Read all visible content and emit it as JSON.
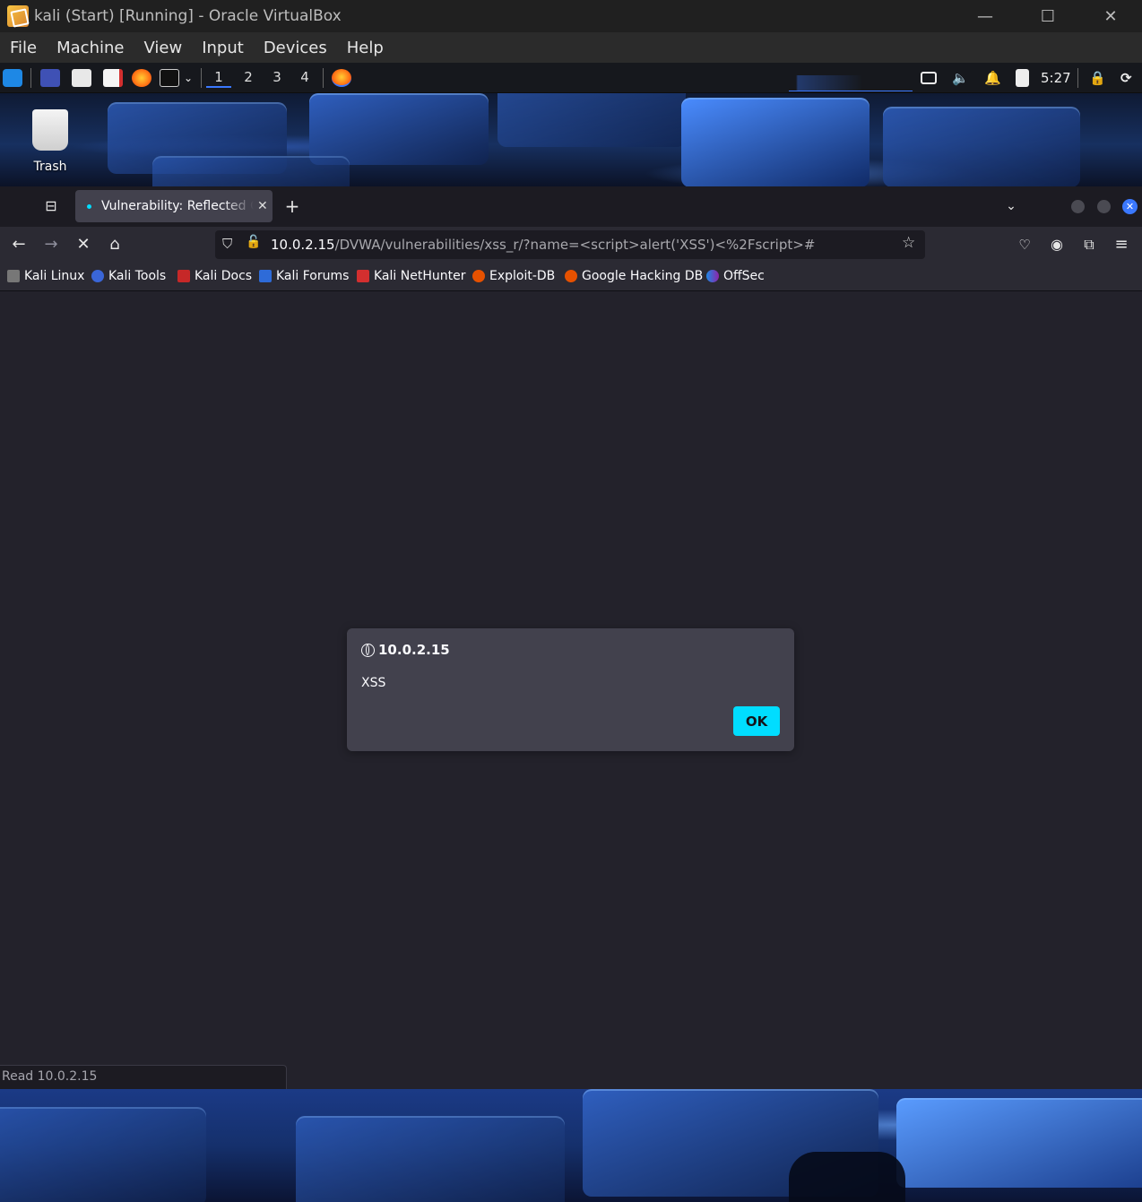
{
  "vbox": {
    "title": "kali (Start) [Running] - Oracle VirtualBox",
    "menu": [
      "File",
      "Machine",
      "View",
      "Input",
      "Devices",
      "Help"
    ],
    "controls": {
      "minimize": "—",
      "maximize": "☐",
      "close": "✕"
    }
  },
  "panel": {
    "workspaces": [
      "1",
      "2",
      "3",
      "4"
    ],
    "active_workspace": "1",
    "clock": "5:27"
  },
  "desktop": {
    "trash_label": "Trash"
  },
  "firefox": {
    "tab_title": "Vulnerability: Reflected Cross Site Scripting",
    "new_tab": "+",
    "url_host": "10.0.2.15",
    "url_path": "/DVWA/vulnerabilities/xss_r/?name=<script>alert('XSS')<%2Fscript>#",
    "bookmarks": [
      "Kali Linux",
      "Kali Tools",
      "Kali Docs",
      "Kali Forums",
      "Kali NetHunter",
      "Exploit-DB",
      "Google Hacking DB",
      "OffSec"
    ],
    "status": "Read 10.0.2.15"
  },
  "alert": {
    "origin": "10.0.2.15",
    "message": "XSS",
    "ok_label": "OK"
  },
  "colors": {
    "accent": "#00ddff",
    "dialog_bg": "#42414d",
    "content_bg": "#23222b"
  }
}
